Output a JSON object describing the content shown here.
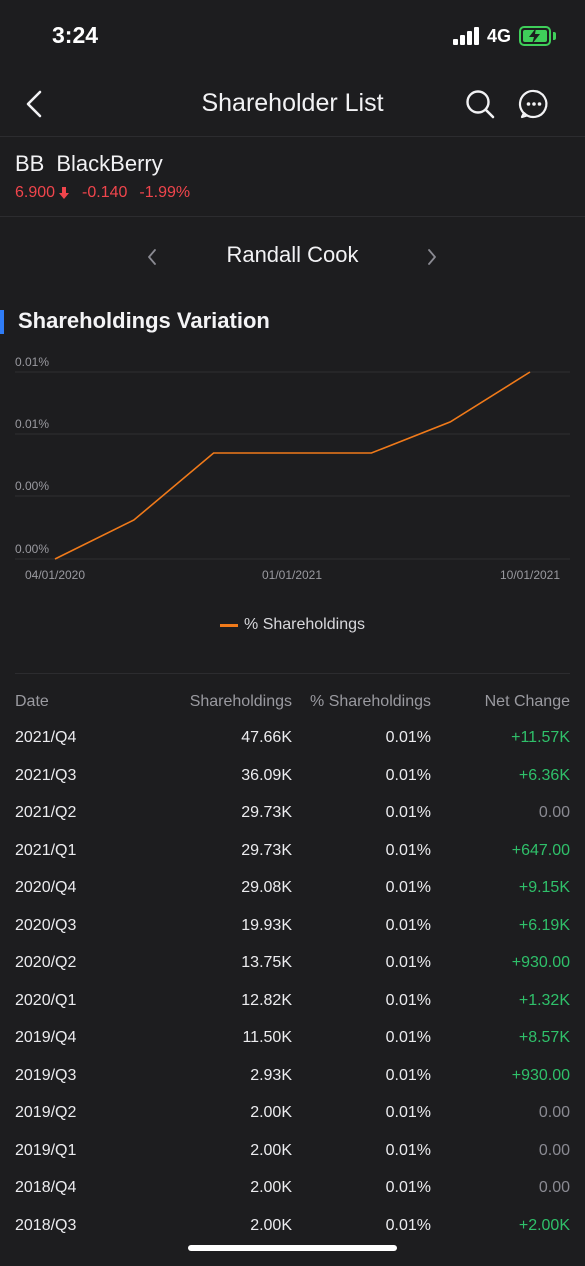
{
  "status": {
    "time": "3:24",
    "network": "4G"
  },
  "nav": {
    "title": "Shareholder List"
  },
  "stock": {
    "ticker": "BB",
    "name": "BlackBerry",
    "price": "6.900",
    "change": "-0.140",
    "change_pct": "-1.99%"
  },
  "holder": {
    "name": "Randall Cook"
  },
  "section": {
    "title": "Shareholdings Variation"
  },
  "colors": {
    "accent": "#2f7cf6",
    "line": "#f07a1a",
    "down": "#f0454c",
    "up": "#2fc06a",
    "background": "#1d1d1f"
  },
  "chart_data": {
    "type": "line",
    "series": [
      {
        "name": "% Shareholdings",
        "points": [
          {
            "x": "2020-04-01",
            "y": 0.002
          },
          {
            "x": "2020-07-01",
            "y": 0.0045
          },
          {
            "x": "2020-10-01",
            "y": 0.0088
          },
          {
            "x": "2021-01-01",
            "y": 0.0088
          },
          {
            "x": "2021-04-01",
            "y": 0.0088
          },
          {
            "x": "2021-07-01",
            "y": 0.0108
          },
          {
            "x": "2021-10-01",
            "y": 0.014
          }
        ]
      }
    ],
    "x_ticks": [
      "04/01/2020",
      "01/01/2021",
      "10/01/2021"
    ],
    "y_ticks": [
      "0.00%",
      "0.00%",
      "0.01%",
      "0.01%"
    ],
    "ylim": [
      0.002,
      0.014
    ],
    "xlim": [
      "2020-04-01",
      "2021-10-01"
    ],
    "grid": true,
    "legend": "bottom-center"
  },
  "table": {
    "headers": {
      "date": "Date",
      "shares": "Shareholdings",
      "pct": "% Shareholdings",
      "net": "Net Change"
    },
    "rows": [
      {
        "date": "2021/Q4",
        "shares": "47.66K",
        "pct": "0.01%",
        "net": "+11.57K"
      },
      {
        "date": "2021/Q3",
        "shares": "36.09K",
        "pct": "0.01%",
        "net": "+6.36K"
      },
      {
        "date": "2021/Q2",
        "shares": "29.73K",
        "pct": "0.01%",
        "net": "0.00"
      },
      {
        "date": "2021/Q1",
        "shares": "29.73K",
        "pct": "0.01%",
        "net": "+647.00"
      },
      {
        "date": "2020/Q4",
        "shares": "29.08K",
        "pct": "0.01%",
        "net": "+9.15K"
      },
      {
        "date": "2020/Q3",
        "shares": "19.93K",
        "pct": "0.01%",
        "net": "+6.19K"
      },
      {
        "date": "2020/Q2",
        "shares": "13.75K",
        "pct": "0.01%",
        "net": "+930.00"
      },
      {
        "date": "2020/Q1",
        "shares": "12.82K",
        "pct": "0.01%",
        "net": "+1.32K"
      },
      {
        "date": "2019/Q4",
        "shares": "11.50K",
        "pct": "0.01%",
        "net": "+8.57K"
      },
      {
        "date": "2019/Q3",
        "shares": "2.93K",
        "pct": "0.01%",
        "net": "+930.00"
      },
      {
        "date": "2019/Q2",
        "shares": "2.00K",
        "pct": "0.01%",
        "net": "0.00"
      },
      {
        "date": "2019/Q1",
        "shares": "2.00K",
        "pct": "0.01%",
        "net": "0.00"
      },
      {
        "date": "2018/Q4",
        "shares": "2.00K",
        "pct": "0.01%",
        "net": "0.00"
      },
      {
        "date": "2018/Q3",
        "shares": "2.00K",
        "pct": "0.01%",
        "net": "+2.00K"
      }
    ]
  }
}
